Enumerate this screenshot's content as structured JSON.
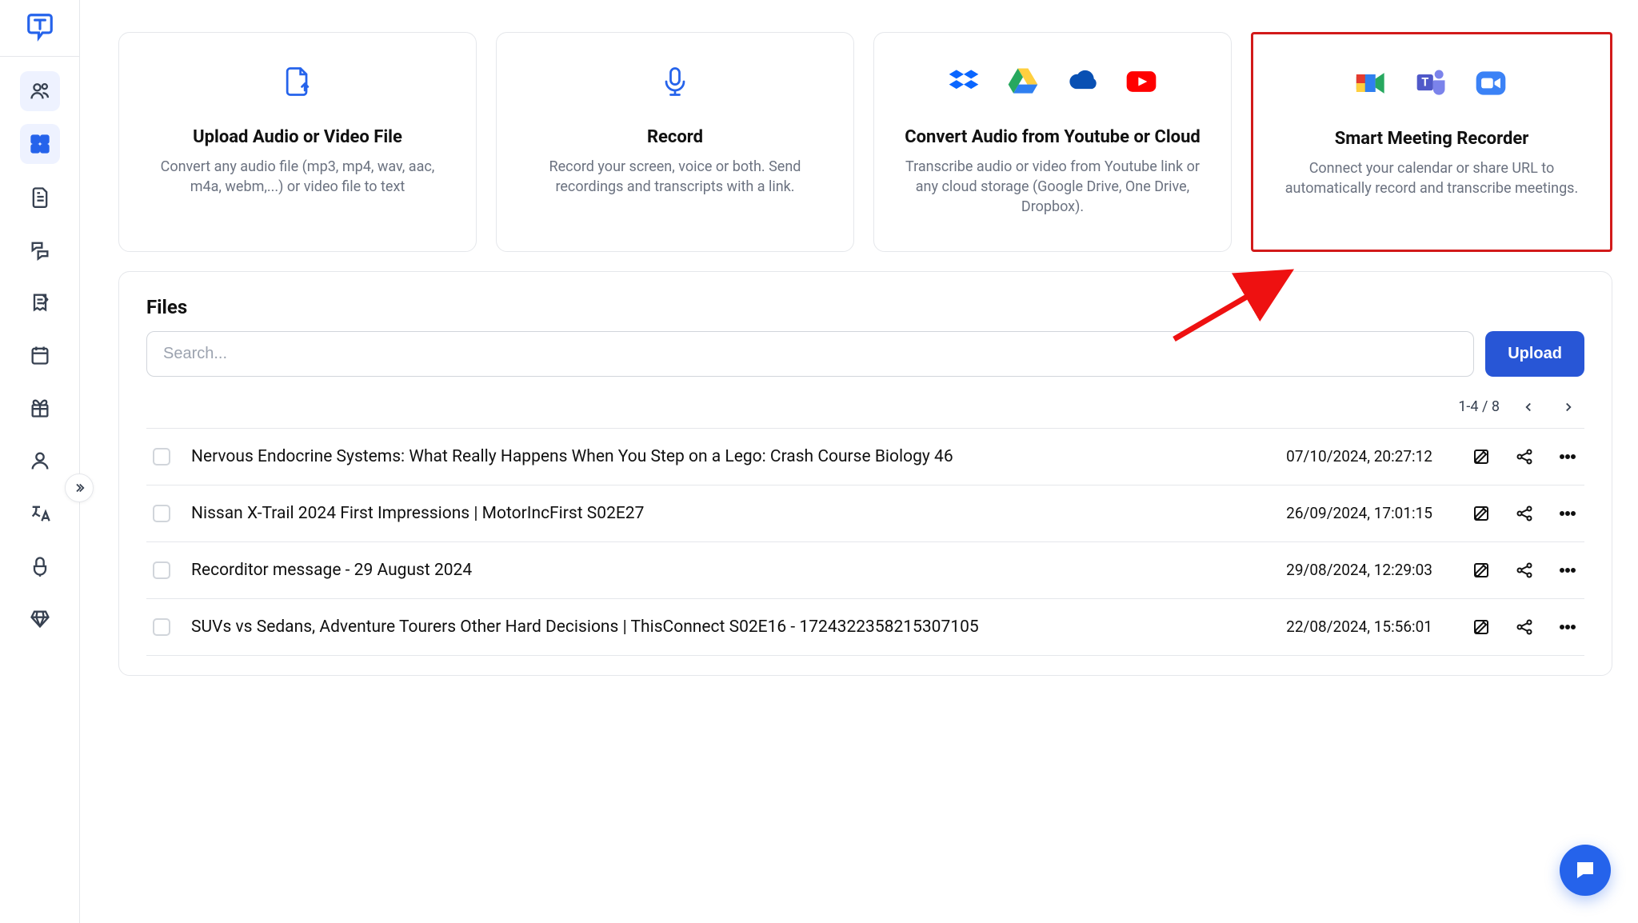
{
  "cards": [
    {
      "title": "Upload Audio or Video File",
      "desc": "Convert any audio file (mp3, mp4, wav, aac, m4a, webm,...) or video file to text"
    },
    {
      "title": "Record",
      "desc": "Record your screen, voice or both. Send recordings and transcripts with a link."
    },
    {
      "title": "Convert Audio from Youtube or Cloud",
      "desc": "Transcribe audio or video from Youtube link or any cloud storage (Google Drive, One Drive, Dropbox)."
    },
    {
      "title": "Smart Meeting Recorder",
      "desc": "Connect your calendar or share URL to automatically record and transcribe meetings."
    }
  ],
  "files": {
    "heading": "Files",
    "search_placeholder": "Search...",
    "upload_label": "Upload",
    "pager": "1-4 / 8",
    "rows": [
      {
        "title": "Nervous Endocrine Systems: What Really Happens When You Step on a Lego: Crash Course Biology 46",
        "date": "07/10/2024, 20:27:12"
      },
      {
        "title": "Nissan X-Trail 2024 First Impressions | MotorIncFirst S02E27",
        "date": "26/09/2024, 17:01:15"
      },
      {
        "title": "Recorditor message - 29 August 2024",
        "date": "29/08/2024, 12:29:03"
      },
      {
        "title": "SUVs vs Sedans, Adventure Tourers Other Hard Decisions | ThisConnect S02E16 - 1724322358215307105",
        "date": "22/08/2024, 15:56:01"
      }
    ]
  }
}
